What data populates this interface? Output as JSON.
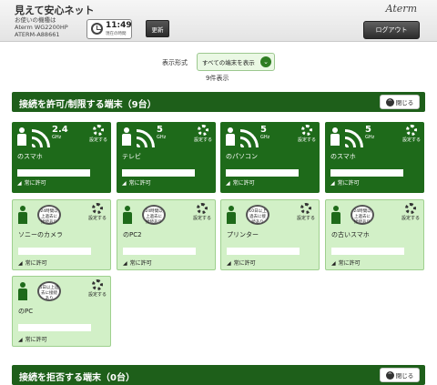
{
  "header": {
    "app_title": "見えて安心ネット",
    "model_label": "お使いの機種は",
    "model_name": "Aterm WG2200HP",
    "device_id": "ATERM-A88661",
    "brand": "Aterm",
    "refresh_label": "更新",
    "logout_label": "ログアウト",
    "clock": {
      "time": "11:49",
      "sub": "現在の時間"
    }
  },
  "filter": {
    "label": "表示形式",
    "selected": "すべての端末を表示",
    "count_text": "9件表示"
  },
  "sections": [
    {
      "title": "接続を許可/制限する端末（9台）",
      "close_label": "閉じる"
    },
    {
      "title": "接続を拒否する端末（0台）",
      "close_label": "閉じる"
    }
  ],
  "devices": [
    {
      "name": "のスマホ",
      "status": "常に許可",
      "band": "2.4",
      "band_unit": "GHz",
      "state": "connected",
      "settings": "設定する"
    },
    {
      "name": "テレビ",
      "status": "常に許可",
      "band": "5",
      "band_unit": "GHz",
      "state": "connected",
      "settings": "設定する"
    },
    {
      "name": "のパソコン",
      "status": "常に許可",
      "band": "5",
      "band_unit": "GHz",
      "state": "connected",
      "settings": "設定する"
    },
    {
      "name": "のスマホ",
      "status": "常に許可",
      "band": "5",
      "band_unit": "GHz",
      "state": "connected",
      "settings": "設定する"
    },
    {
      "name": "ソニーのカメラ",
      "status": "常に許可",
      "badge": "24時間以上過去に接続あり",
      "state": "past",
      "settings": "設定する"
    },
    {
      "name": "のPC2",
      "status": "常に許可",
      "badge": "24時間以上過去に接続あり",
      "state": "past",
      "settings": "設定する"
    },
    {
      "name": "プリンター",
      "status": "常に許可",
      "badge": "10日以上過去に接続あり",
      "state": "past",
      "settings": "設定する"
    },
    {
      "name": "の古いスマホ",
      "status": "常に許可",
      "badge": "24時間以上過去に接続あり",
      "state": "past",
      "settings": "設定する"
    },
    {
      "name": "のPC",
      "status": "常に許可",
      "badge": "5日以上過去に接続あり",
      "state": "past",
      "settings": "設定する"
    }
  ]
}
